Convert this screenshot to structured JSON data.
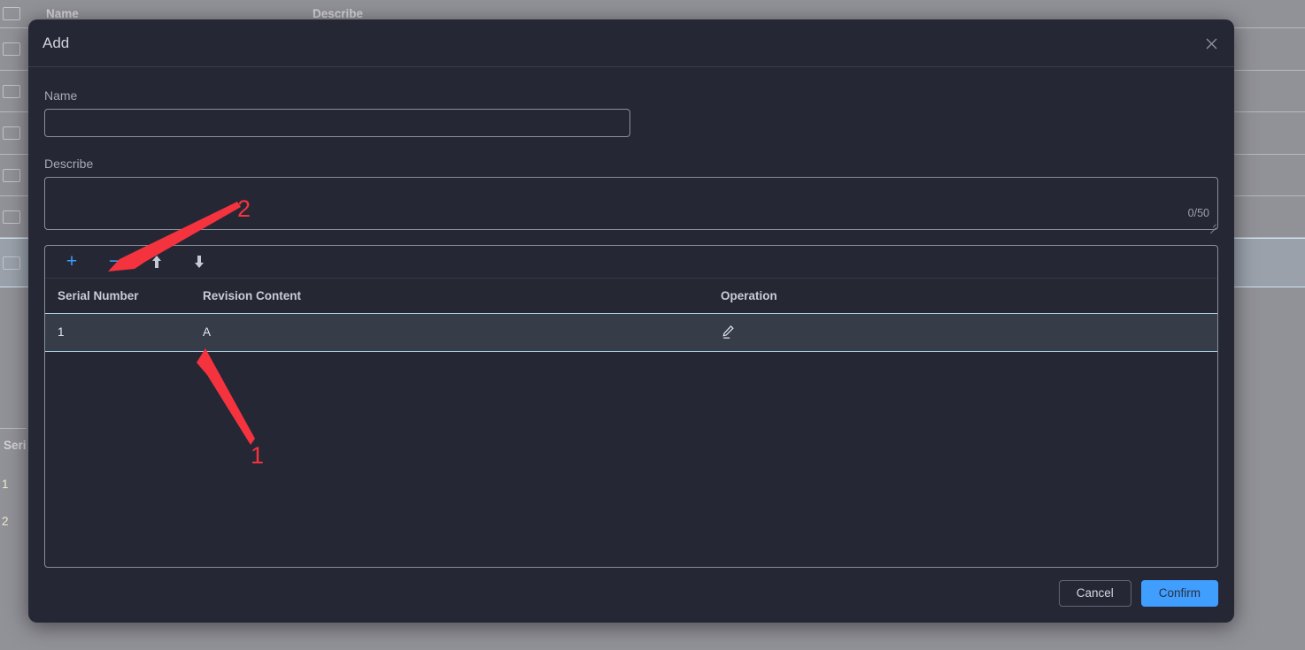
{
  "background": {
    "table_headers": {
      "name": "Name",
      "describe": "Describe"
    },
    "sub_table_header": "Seri",
    "sub_rows": [
      "1",
      "2"
    ],
    "checkbox_icon": "checkbox-icon"
  },
  "dialog": {
    "title": "Add",
    "close_icon": "close-icon",
    "fields": {
      "name_label": "Name",
      "name_value": "",
      "name_placeholder": "",
      "describe_label": "Describe",
      "describe_value": "",
      "describe_placeholder": "",
      "describe_counter": "0/50"
    },
    "toolbar": {
      "add_icon": "plus-icon",
      "add_label": "+",
      "remove_icon": "minus-icon",
      "remove_label": "−",
      "move_up_icon": "arrow-up-icon",
      "move_down_icon": "arrow-down-icon"
    },
    "table": {
      "columns": [
        "Serial Number",
        "Revision Content",
        "Operation"
      ],
      "rows": [
        {
          "serial": "1",
          "content": "A",
          "operation_icon": "pencil-edit-icon"
        }
      ]
    },
    "footer": {
      "cancel_label": "Cancel",
      "confirm_label": "Confirm"
    }
  },
  "annotations": {
    "markers": [
      {
        "label": "2",
        "target": "remove-row-button"
      },
      {
        "label": "1",
        "target": "revision-content-cell"
      }
    ],
    "color": "#f5333f"
  },
  "colors": {
    "accent_blue": "#409eff",
    "dialog_bg": "#252834",
    "row_highlight": "#363c48",
    "backdrop": "#919198",
    "annotation_red": "#f5333f"
  }
}
